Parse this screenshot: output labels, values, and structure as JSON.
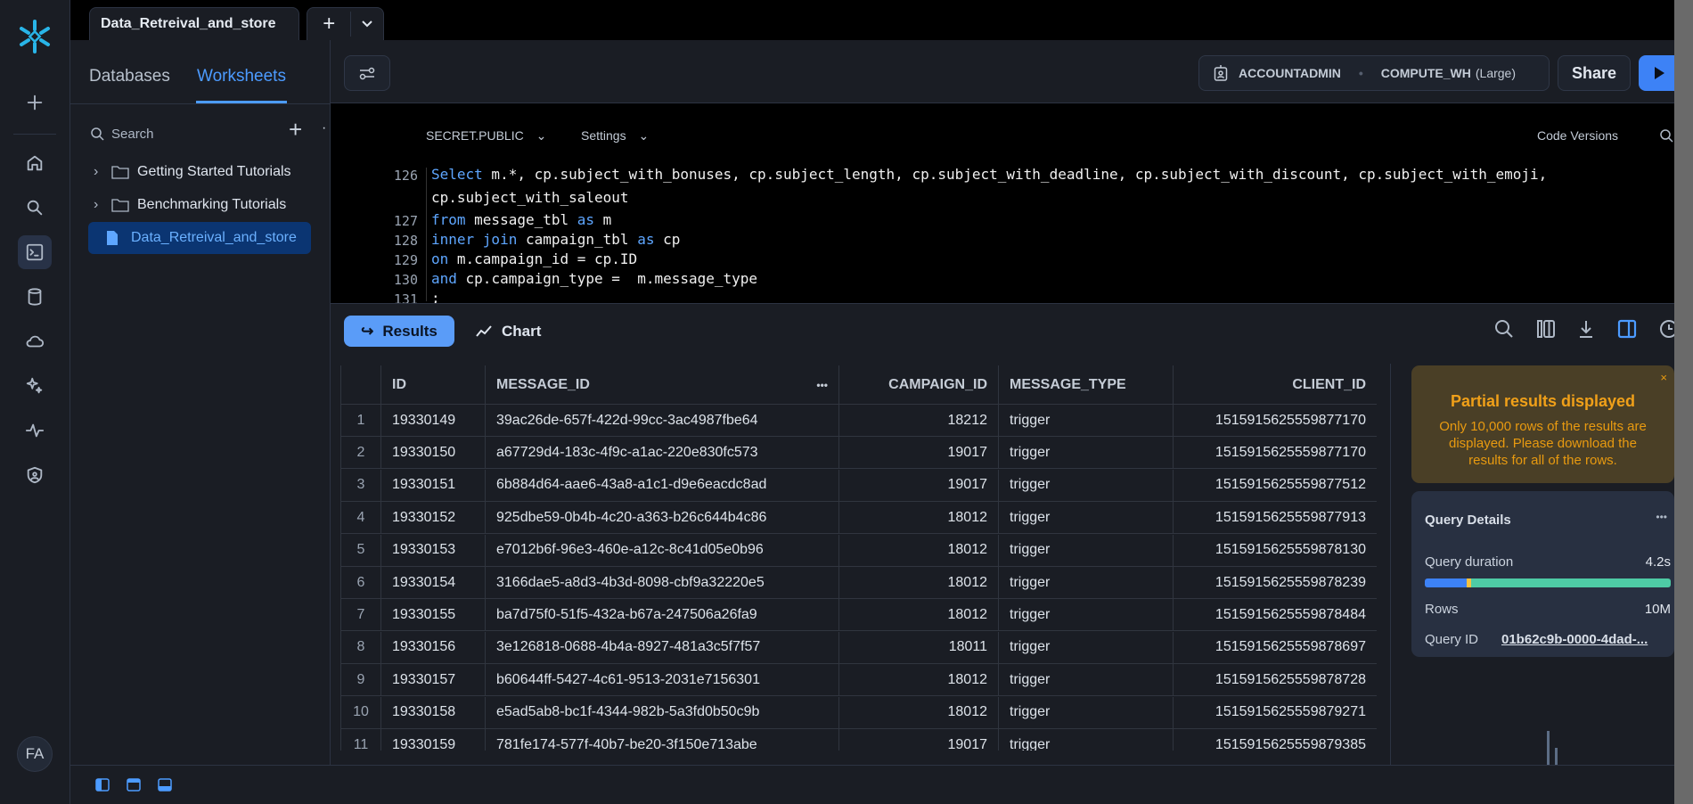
{
  "app": {
    "brand": "Snowflake",
    "accent": "#3d82f6",
    "avatar_initials": "FA"
  },
  "rail": {
    "items": [
      {
        "icon": "plus-icon"
      },
      {
        "icon": "home-icon"
      },
      {
        "icon": "search-icon"
      },
      {
        "icon": "worksheets-icon",
        "active": true
      },
      {
        "icon": "database-icon"
      },
      {
        "icon": "cloud-icon"
      },
      {
        "icon": "sparkle-icon"
      },
      {
        "icon": "activity-icon"
      },
      {
        "icon": "admin-shield-icon"
      }
    ]
  },
  "tabs": {
    "active": "Data_Retreival_and_store"
  },
  "sidebar": {
    "tabs": [
      {
        "label": "Databases"
      },
      {
        "label": "Worksheets",
        "active": true
      }
    ],
    "search_placeholder": "Search",
    "items": [
      {
        "label": "Getting Started Tutorials",
        "type": "folder"
      },
      {
        "label": "Benchmarking Tutorials",
        "type": "folder"
      },
      {
        "label": "Data_Retreival_and_store",
        "type": "worksheet",
        "selected": true
      }
    ]
  },
  "toolbar": {
    "role": "ACCOUNTADMIN",
    "warehouse": "COMPUTE_WH",
    "warehouse_size": "(Large)",
    "share": "Share"
  },
  "editor": {
    "context": "SECRET.PUBLIC",
    "settings": "Settings",
    "code_versions": "Code Versions",
    "lines": [
      {
        "n": "126",
        "segs": [
          [
            "Select",
            1
          ],
          [
            " m.*, cp.subject_with_bonuses, cp.subject_length, cp.subject_with_deadline, cp.subject_with_discount, cp.subject_with_emoji,",
            0
          ]
        ]
      },
      {
        "n": "",
        "segs": [
          [
            "cp.subject_with_saleout",
            0
          ]
        ]
      },
      {
        "n": "127",
        "segs": [
          [
            "from",
            1
          ],
          [
            " message_tbl ",
            0
          ],
          [
            "as",
            1
          ],
          [
            " m",
            0
          ]
        ]
      },
      {
        "n": "128",
        "segs": [
          [
            "inner join",
            1
          ],
          [
            " campaign_tbl ",
            0
          ],
          [
            "as",
            1
          ],
          [
            " cp",
            0
          ]
        ]
      },
      {
        "n": "129",
        "segs": [
          [
            "on",
            1
          ],
          [
            " m.campaign_id = cp.ID",
            0
          ]
        ]
      },
      {
        "n": "130",
        "segs": [
          [
            "and",
            1
          ],
          [
            " cp.campaign_type =  m.message_type",
            0
          ]
        ]
      },
      {
        "n": "131",
        "segs": [
          [
            ";",
            0
          ]
        ]
      }
    ]
  },
  "results": {
    "tabs": [
      {
        "label": "Results",
        "active": true
      },
      {
        "label": "Chart"
      }
    ],
    "columns": [
      "",
      "ID",
      "MESSAGE_ID",
      "CAMPAIGN_ID",
      "MESSAGE_TYPE",
      "CLIENT_ID"
    ],
    "rows": [
      [
        "1",
        "19330149",
        "39ac26de-657f-422d-99cc-3ac4987fbe64",
        "18212",
        "trigger",
        "1515915625559877170"
      ],
      [
        "2",
        "19330150",
        "a67729d4-183c-4f9c-a1ac-220e830fc573",
        "19017",
        "trigger",
        "1515915625559877170"
      ],
      [
        "3",
        "19330151",
        "6b884d64-aae6-43a8-a1c1-d9e6eacdc8ad",
        "19017",
        "trigger",
        "1515915625559877512"
      ],
      [
        "4",
        "19330152",
        "925dbe59-0b4b-4c20-a363-b26c644b4c86",
        "18012",
        "trigger",
        "1515915625559877913"
      ],
      [
        "5",
        "19330153",
        "e7012b6f-96e3-460e-a12c-8c41d05e0b96",
        "18012",
        "trigger",
        "1515915625559878130"
      ],
      [
        "6",
        "19330154",
        "3166dae5-a8d3-4b3d-8098-cbf9a32220e5",
        "18012",
        "trigger",
        "1515915625559878239"
      ],
      [
        "7",
        "19330155",
        "ba7d75f0-51f5-432a-b67a-247506a26fa9",
        "18012",
        "trigger",
        "1515915625559878484"
      ],
      [
        "8",
        "19330156",
        "3e126818-0688-4b4a-8927-481a3c5f7f57",
        "18011",
        "trigger",
        "1515915625559878697"
      ],
      [
        "9",
        "19330157",
        "b60644ff-5427-4c61-9513-2031e7156301",
        "18012",
        "trigger",
        "1515915625559878728"
      ],
      [
        "10",
        "19330158",
        "e5ad5ab8-bc1f-4344-982b-5a3fd0b50c9b",
        "18012",
        "trigger",
        "1515915625559879271"
      ],
      [
        "11",
        "19330159",
        "781fe174-577f-40b7-be20-3f150e713abe",
        "19017",
        "trigger",
        "1515915625559879385"
      ]
    ]
  },
  "notice": {
    "title": "Partial results displayed",
    "body": "Only 10,000 rows of the results are displayed. Please download the results for all of the rows.",
    "close": "×"
  },
  "query_details": {
    "title": "Query Details",
    "menu": "•••",
    "duration_label": "Query duration",
    "duration": "4.2s",
    "duration_breakdown": [
      {
        "pct": 17,
        "color": "#3d82f6"
      },
      {
        "pct": 2,
        "color": "#f5c242"
      },
      {
        "pct": 81,
        "color": "#4ecba5"
      }
    ],
    "rows_label": "Rows",
    "rows": "10M",
    "query_id_label": "Query ID",
    "query_id": "01b62c9b-0000-4dad-..."
  }
}
